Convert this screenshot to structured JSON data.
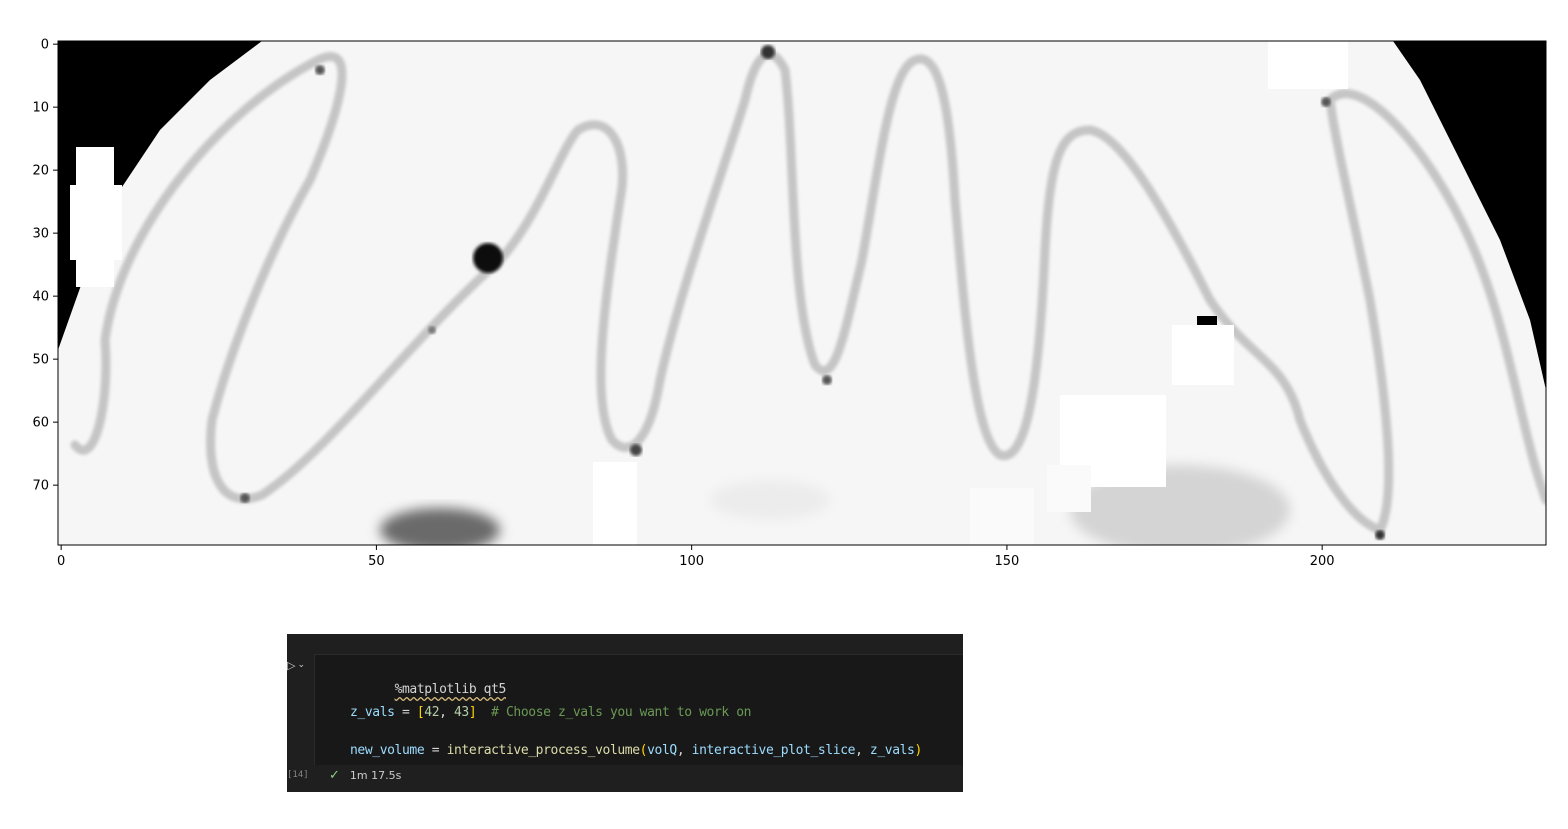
{
  "plot": {
    "type": "image",
    "colormap": "gray_r",
    "x_ticks": [
      "0",
      "50",
      "100",
      "150",
      "200"
    ],
    "y_ticks": [
      "0",
      "10",
      "20",
      "30",
      "40",
      "50",
      "60",
      "70"
    ],
    "xlim": [
      0,
      236
    ],
    "ylim": [
      80,
      0
    ]
  },
  "cell": {
    "execution_count": "[14]",
    "line1_magic": "%matplotlib qt5",
    "line2": {
      "var": "z_vals",
      "eq": " = ",
      "open": "[",
      "n1": "42",
      "sep": ", ",
      "n2": "43",
      "close": "]",
      "comment": "  # Choose z_vals you want to work on"
    },
    "line3": {
      "var": "new_volume",
      "eq": " = ",
      "fn": "interactive_process_volume",
      "open": "(",
      "arg1": "volQ",
      "sep1": ", ",
      "arg2": "interactive_plot_slice",
      "sep2": ", ",
      "arg3": "z_vals",
      "close": ")"
    },
    "status_time": "1m 17.5s",
    "status_icon": "check-icon"
  }
}
